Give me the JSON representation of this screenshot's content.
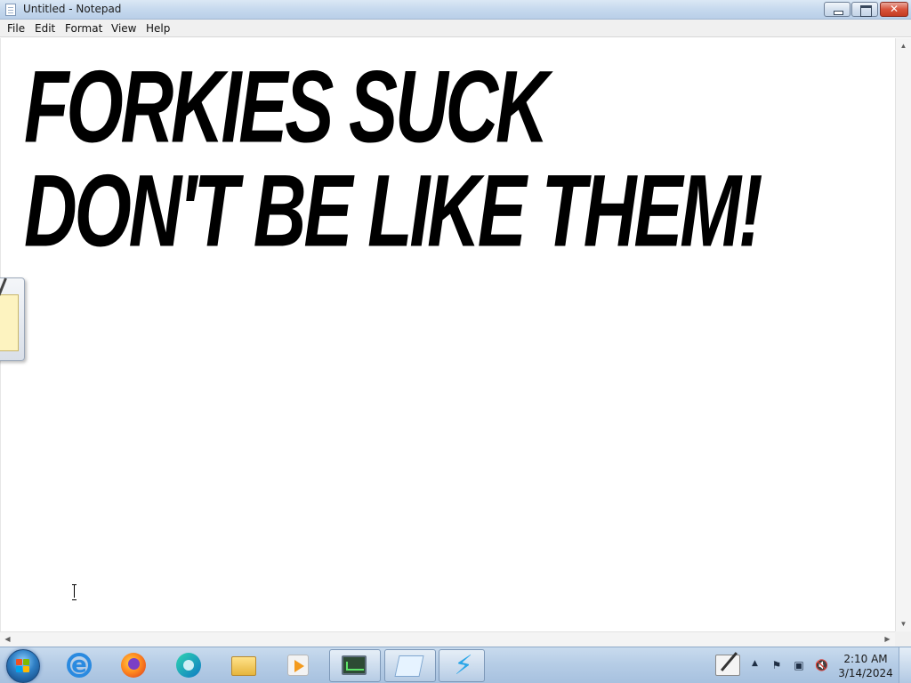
{
  "window": {
    "title": "Untitled - Notepad",
    "icon": "notepad-icon"
  },
  "menu": {
    "items": [
      {
        "label": "File"
      },
      {
        "label": "Edit"
      },
      {
        "label": "Format"
      },
      {
        "label": "View"
      },
      {
        "label": "Help"
      }
    ]
  },
  "editor": {
    "lines": [
      "FORKIES SUCK",
      "DON'T BE LIKE THEM!"
    ]
  },
  "taskbar": {
    "apps": [
      {
        "name": "internet-explorer-icon"
      },
      {
        "name": "firefox-icon"
      },
      {
        "name": "edge-icon"
      },
      {
        "name": "file-explorer-icon"
      },
      {
        "name": "media-player-icon"
      },
      {
        "name": "performance-monitor-icon",
        "active": true
      },
      {
        "name": "notepad-icon",
        "active": true
      },
      {
        "name": "lightning-bolt-icon",
        "active": true
      }
    ],
    "tray": {
      "time": "2:10 AM",
      "date": "3/14/2024"
    }
  },
  "colors": {
    "close_button": "#c43b22",
    "taskbar": "#b6cde6",
    "text": "#000000"
  }
}
